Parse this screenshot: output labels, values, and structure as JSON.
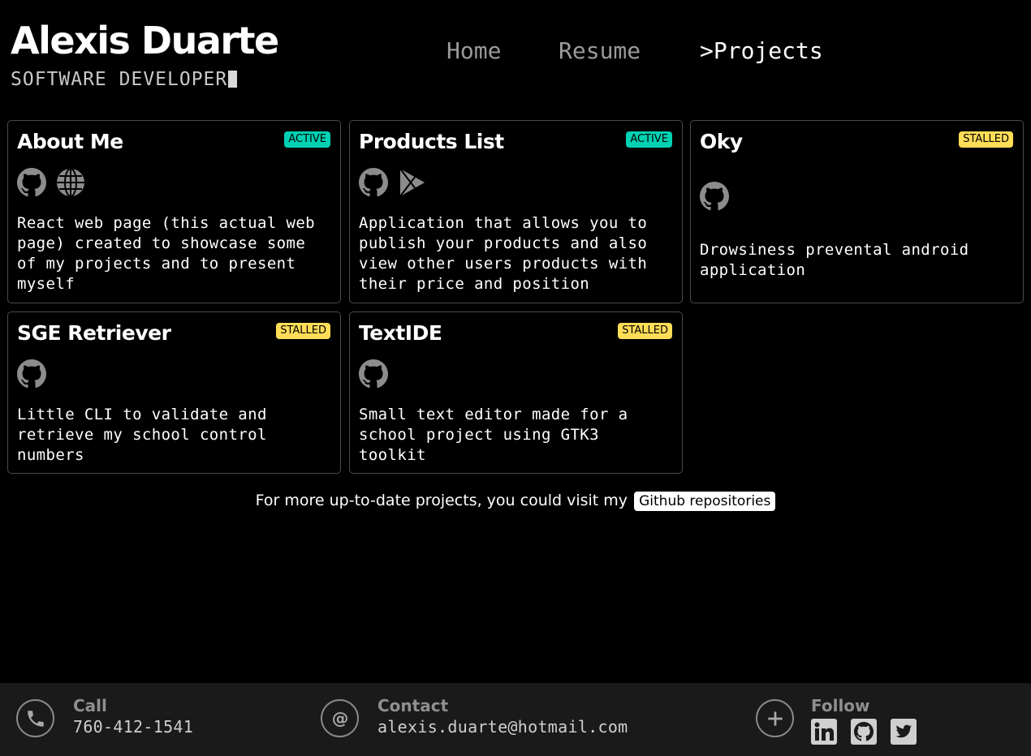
{
  "brand": {
    "name": "Alexis Duarte",
    "role": "SOFTWARE DEVELOPER"
  },
  "nav": {
    "home": "Home",
    "resume": "Resume",
    "projects": ">Projects",
    "active": "projects"
  },
  "projects": [
    {
      "title": "About Me",
      "status": "ACTIVE",
      "links": [
        "github-icon",
        "globe-icon"
      ],
      "description": "React web page (this actual web page) created to showcase some of my projects and to present myself"
    },
    {
      "title": "Products List",
      "status": "ACTIVE",
      "links": [
        "github-icon",
        "google-play-icon"
      ],
      "description": "Application that allows you to publish your products and also view other users products with their price and position"
    },
    {
      "title": "Oky",
      "status": "STALLED",
      "links": [
        "github-icon"
      ],
      "description": "Drowsiness prevental android application"
    },
    {
      "title": "SGE Retriever",
      "status": "STALLED",
      "links": [
        "github-icon"
      ],
      "description": "Little CLI to validate and retrieve my school control numbers"
    },
    {
      "title": "TextIDE",
      "status": "STALLED",
      "links": [
        "github-icon"
      ],
      "description": "Small text editor made for a school project using GTK3 toolkit"
    }
  ],
  "more": {
    "text": "For more up-to-date projects, you could visit my",
    "link_label": "Github repositories"
  },
  "footer": {
    "call": {
      "label": "Call",
      "value": "760-412-1541",
      "icon": "phone-icon"
    },
    "contact": {
      "label": "Contact",
      "value": "alexis.duarte@hotmail.com",
      "icon": "at-icon"
    },
    "follow": {
      "label": "Follow",
      "icon": "plus-icon",
      "links": [
        "linkedin-icon",
        "github-icon",
        "twitter-icon"
      ]
    }
  },
  "colors": {
    "active": "#00d1b2",
    "stalled": "#ffdd57",
    "footer_bg": "#1a1a1a",
    "card_border": "#4a4a4a"
  }
}
